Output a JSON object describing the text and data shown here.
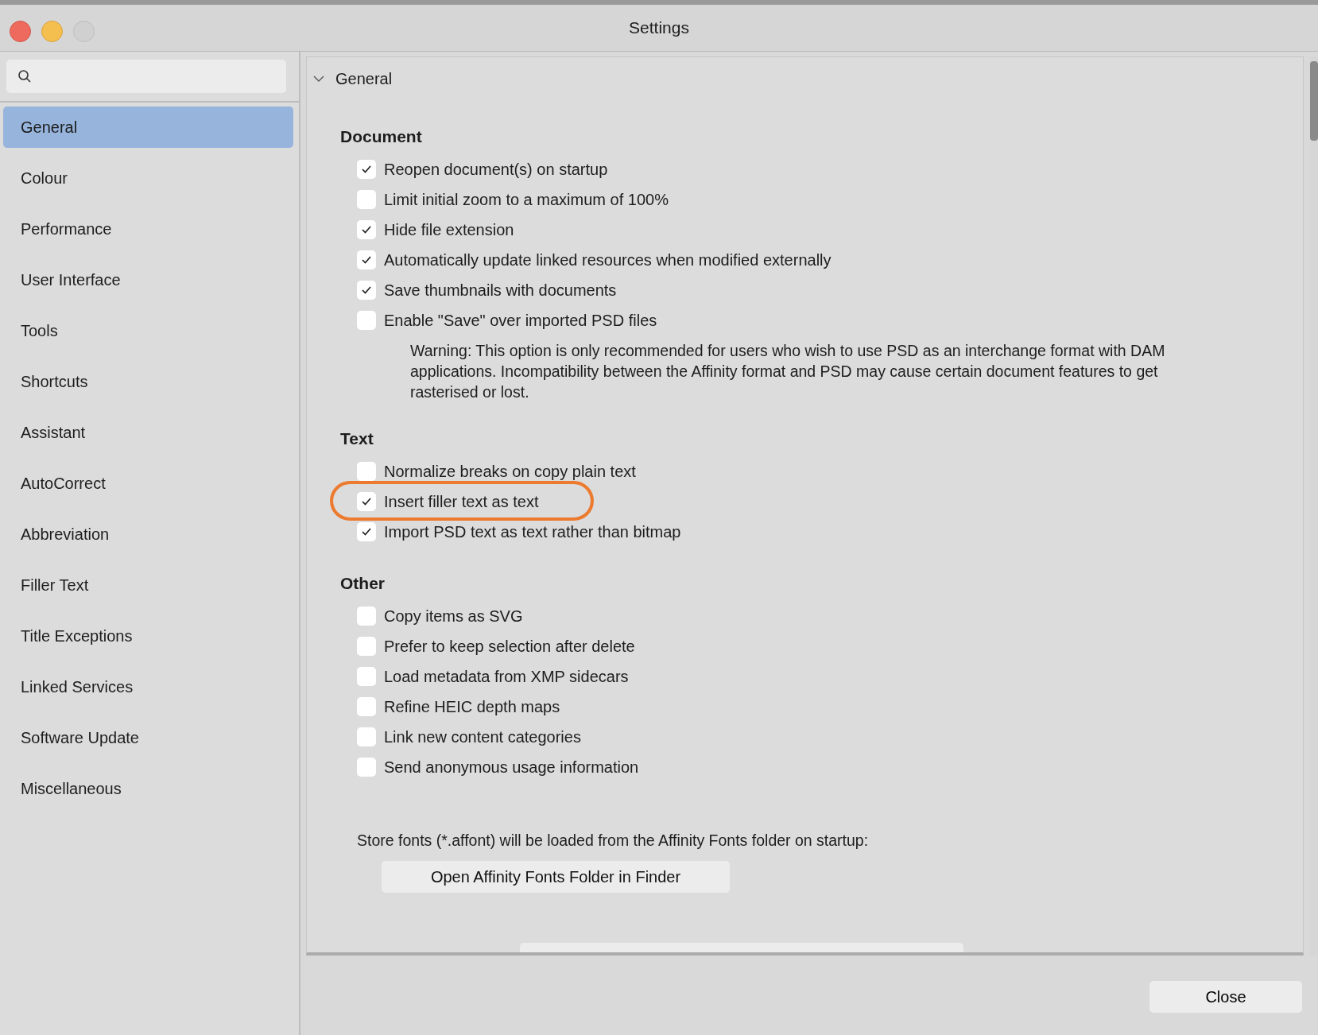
{
  "window": {
    "title": "Settings"
  },
  "sidebar": {
    "items": [
      {
        "label": "General",
        "selected": true
      },
      {
        "label": "Colour",
        "selected": false
      },
      {
        "label": "Performance",
        "selected": false
      },
      {
        "label": "User Interface",
        "selected": false
      },
      {
        "label": "Tools",
        "selected": false
      },
      {
        "label": "Shortcuts",
        "selected": false
      },
      {
        "label": "Assistant",
        "selected": false
      },
      {
        "label": "AutoCorrect",
        "selected": false
      },
      {
        "label": "Abbreviation",
        "selected": false
      },
      {
        "label": "Filler Text",
        "selected": false
      },
      {
        "label": "Title Exceptions",
        "selected": false
      },
      {
        "label": "Linked Services",
        "selected": false
      },
      {
        "label": "Software Update",
        "selected": false
      },
      {
        "label": "Miscellaneous",
        "selected": false
      }
    ]
  },
  "group": {
    "title": "General",
    "expanded": true
  },
  "sections": [
    {
      "title": "Document",
      "items": [
        {
          "kind": "checkbox",
          "label": "Reopen document(s) on startup",
          "checked": true
        },
        {
          "kind": "checkbox",
          "label": "Limit initial zoom to a maximum of 100%",
          "checked": false
        },
        {
          "kind": "checkbox",
          "label": "Hide file extension",
          "checked": true
        },
        {
          "kind": "checkbox",
          "label": "Automatically update linked resources when modified externally",
          "checked": true
        },
        {
          "kind": "checkbox",
          "label": "Save thumbnails with documents",
          "checked": true
        },
        {
          "kind": "checkbox",
          "label": "Enable \"Save\" over imported PSD files",
          "checked": false
        },
        {
          "kind": "note",
          "label": "Warning: This option is only recommended for users who wish to use PSD as an interchange format with DAM applications. Incompatibility between the Affinity format and PSD may cause certain document features to get rasterised or lost."
        }
      ]
    },
    {
      "title": "Text",
      "items": [
        {
          "kind": "checkbox",
          "label": "Normalize breaks on copy plain text",
          "checked": false
        },
        {
          "kind": "checkbox",
          "label": "Insert filler text as text",
          "checked": true,
          "highlighted": true
        },
        {
          "kind": "checkbox",
          "label": "Import PSD text as text rather than bitmap",
          "checked": true
        }
      ]
    },
    {
      "title": "Other",
      "items": [
        {
          "kind": "checkbox",
          "label": "Copy items as SVG",
          "checked": false
        },
        {
          "kind": "checkbox",
          "label": "Prefer to keep selection after delete",
          "checked": false
        },
        {
          "kind": "checkbox",
          "label": "Load metadata from XMP sidecars",
          "checked": false
        },
        {
          "kind": "checkbox",
          "label": "Refine HEIC depth maps",
          "checked": false
        },
        {
          "kind": "checkbox",
          "label": "Link new content categories",
          "checked": false
        },
        {
          "kind": "checkbox",
          "label": "Send anonymous usage information",
          "checked": false
        }
      ]
    }
  ],
  "fonts": {
    "text": "Store fonts (*.affont) will be loaded from the Affinity Fonts folder on startup:",
    "button": "Open Affinity Fonts Folder in Finder"
  },
  "footer": {
    "button": "Close"
  }
}
